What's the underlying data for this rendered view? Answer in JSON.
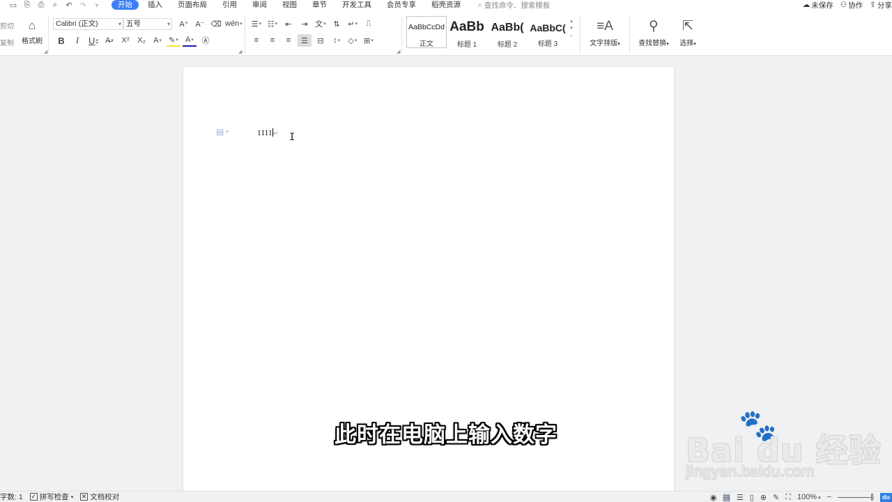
{
  "menubar": {
    "tabs": [
      "开始",
      "插入",
      "页面布局",
      "引用",
      "审阅",
      "视图",
      "章节",
      "开发工具",
      "会员专享",
      "稻壳资源"
    ],
    "active_tab": "开始",
    "search_placeholder": "查找命令、搜索模板",
    "unsaved": "未保存",
    "collab": "协作",
    "share": "分享"
  },
  "ribbon": {
    "cut": "剪切",
    "copy": "复制",
    "format_painter": "格式刷",
    "font_name": "Calibri (正文)",
    "font_size": "五号",
    "styles": [
      {
        "sample": "AaBbCcDd",
        "name": "正文"
      },
      {
        "sample": "AaBb",
        "name": "标题 1"
      },
      {
        "sample": "AaBb(",
        "name": "标题 2"
      },
      {
        "sample": "AaBbC(",
        "name": "标题 3"
      }
    ],
    "text_layout": "文字排版",
    "find_replace": "查找替换",
    "select": "选择"
  },
  "document": {
    "text": "1111"
  },
  "subtitle": "此时在电脑上输入数字",
  "watermark": {
    "logo": "Bai du 经验",
    "url": "jingyan.baidu.com"
  },
  "statusbar": {
    "word_count": "字数: 1",
    "spell_check": "拼写检查",
    "doc_proof": "文档校对",
    "zoom": "100%",
    "du_badge": "du"
  },
  "colors": {
    "accent": "#3b7ff5",
    "font_color_underline": "#1a1aa8",
    "highlight_underline": "#f3e233"
  }
}
